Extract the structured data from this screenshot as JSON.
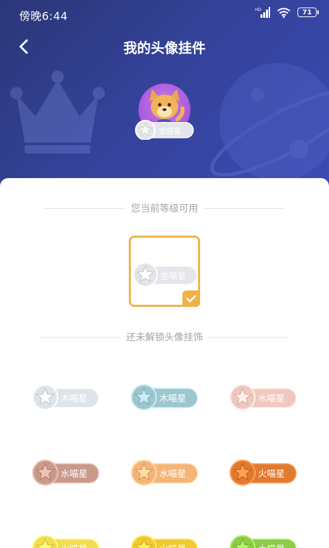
{
  "status_bar": {
    "time": "傍晚6:44",
    "battery": "71",
    "network_label": "HD"
  },
  "nav": {
    "title": "我的头像挂件",
    "back_icon": "chevron-left-icon"
  },
  "current_badge": {
    "label": "金喵星",
    "color": "#e3e5ea"
  },
  "sections": {
    "available_label": "您当前等级可用",
    "locked_label": "还未解锁头像挂饰"
  },
  "available_items": [
    {
      "label": "金喵星",
      "color": "#e3e5ea",
      "selected": true
    }
  ],
  "locked_items": [
    {
      "label": "木喵星",
      "color": "#dfe4ea"
    },
    {
      "label": "木喵星",
      "color": "#9ec6cf"
    },
    {
      "label": "水喵星",
      "color": "#f0c8bf"
    },
    {
      "label": "水喵星",
      "color": "#c79a8c"
    },
    {
      "label": "水喵星",
      "color": "#f4b47a"
    },
    {
      "label": "火喵星",
      "color": "#e07a30"
    },
    {
      "label": "火喵星",
      "color": "#f2db55"
    },
    {
      "label": "火喵星",
      "color": "#f0c935"
    },
    {
      "label": "土喵星",
      "color": "#8dcb48"
    }
  ],
  "colors": {
    "header_start": "#2b3777",
    "header_end": "#3b4bb3",
    "accent": "#f0b248"
  }
}
